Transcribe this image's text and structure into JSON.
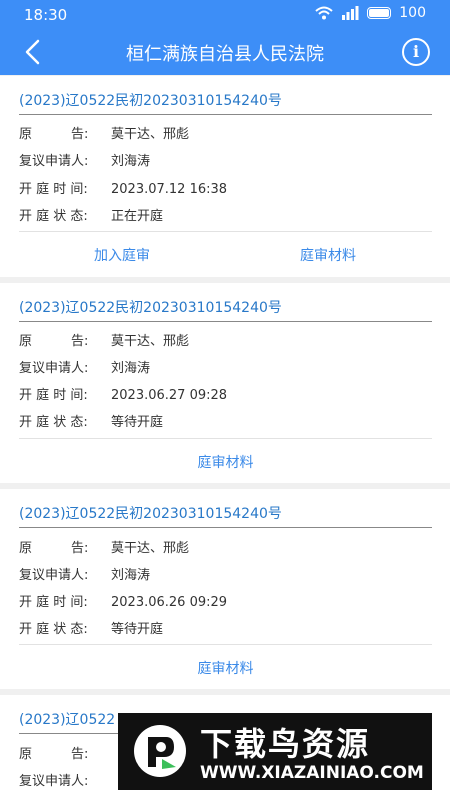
{
  "status": {
    "time": "18:30",
    "battery": "100"
  },
  "appbar": {
    "title": "桓仁满族自治县人民法院"
  },
  "labels": {
    "plaintiff": "原　　　告:",
    "applicant": "复议申请人:",
    "time": "开 庭 时 间:",
    "state": "开 庭 状 态:"
  },
  "cases": [
    {
      "case_no": "(2023)辽0522民初20230310154240号",
      "plaintiff": "莫干达、邢彪",
      "applicant": "刘海涛",
      "time": "2023.07.12 16:38",
      "state": "正在开庭",
      "actions": [
        "加入庭审",
        "庭审材料"
      ]
    },
    {
      "case_no": "(2023)辽0522民初20230310154240号",
      "plaintiff": "莫干达、邢彪",
      "applicant": "刘海涛",
      "time": "2023.06.27 09:28",
      "state": "等待开庭",
      "actions": [
        "庭审材料"
      ]
    },
    {
      "case_no": "(2023)辽0522民初20230310154240号",
      "plaintiff": "莫干达、邢彪",
      "applicant": "刘海涛",
      "time": "2023.06.26 09:29",
      "state": "等待开庭",
      "actions": [
        "庭审材料"
      ]
    },
    {
      "case_no": "(2023)辽0522",
      "plaintiff": "",
      "applicant": "",
      "time": "",
      "state": "",
      "actions": []
    }
  ],
  "watermark": {
    "title": "下载鸟资源",
    "url": "WWW.XIAZAINIAO.COM"
  }
}
